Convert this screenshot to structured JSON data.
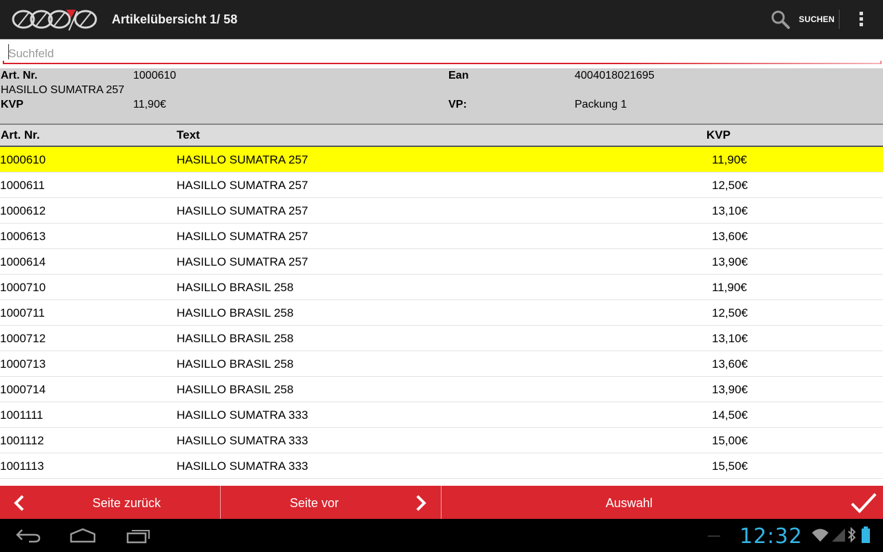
{
  "app": {
    "title": "Artikelübersicht 1/ 58",
    "logo_icon": "brand-logo",
    "accent_color": "#d9262f",
    "highlight_color": "#ffff00"
  },
  "actionbar": {
    "search_icon": "search-icon",
    "search_label": "SUCHEN",
    "overflow_icon": "overflow-menu-icon"
  },
  "search": {
    "placeholder": "Suchfeld",
    "value": ""
  },
  "detail": {
    "artnr_label": "Art. Nr.",
    "artnr_value": "1000610",
    "ean_label": "Ean",
    "ean_value": "4004018021695",
    "name": "HASILLO SUMATRA 257",
    "kvp_label": "KVP",
    "kvp_value": "11,90€",
    "vp_label": "VP:",
    "vp_value": "Packung 1"
  },
  "table": {
    "headers": [
      "Art. Nr.",
      "Text",
      "KVP"
    ],
    "selected_index": 0,
    "rows": [
      {
        "artnr": "1000610",
        "text": "HASILLO SUMATRA 257",
        "kvp": "11,90€"
      },
      {
        "artnr": "1000611",
        "text": "HASILLO SUMATRA 257",
        "kvp": "12,50€"
      },
      {
        "artnr": "1000612",
        "text": "HASILLO SUMATRA 257",
        "kvp": "13,10€"
      },
      {
        "artnr": "1000613",
        "text": "HASILLO SUMATRA 257",
        "kvp": "13,60€"
      },
      {
        "artnr": "1000614",
        "text": "HASILLO SUMATRA 257",
        "kvp": "13,90€"
      },
      {
        "artnr": "1000710",
        "text": "HASILLO BRASIL 258",
        "kvp": "11,90€"
      },
      {
        "artnr": "1000711",
        "text": "HASILLO BRASIL 258",
        "kvp": "12,50€"
      },
      {
        "artnr": "1000712",
        "text": "HASILLO BRASIL 258",
        "kvp": "13,10€"
      },
      {
        "artnr": "1000713",
        "text": "HASILLO BRASIL 258",
        "kvp": "13,60€"
      },
      {
        "artnr": "1000714",
        "text": "HASILLO BRASIL 258",
        "kvp": "13,90€"
      },
      {
        "artnr": "1001111",
        "text": "HASILLO SUMATRA 333",
        "kvp": "14,50€"
      },
      {
        "artnr": "1001112",
        "text": "HASILLO SUMATRA 333",
        "kvp": "15,00€"
      },
      {
        "artnr": "1001113",
        "text": "HASILLO SUMATRA 333",
        "kvp": "15,50€"
      }
    ]
  },
  "buttons": {
    "prev_label": "Seite zurück",
    "prev_icon": "chevron-left-icon",
    "next_label": "Seite vor",
    "next_icon": "chevron-right-icon",
    "select_label": "Auswahl",
    "select_icon": "checkmark-icon"
  },
  "system": {
    "back_icon": "back-icon",
    "home_icon": "home-icon",
    "recents_icon": "recent-apps-icon",
    "time": "12:32",
    "wifi_icon": "wifi-icon",
    "signal_icon": "signal-icon",
    "bluetooth_icon": "bluetooth-icon",
    "battery_icon": "battery-icon"
  }
}
